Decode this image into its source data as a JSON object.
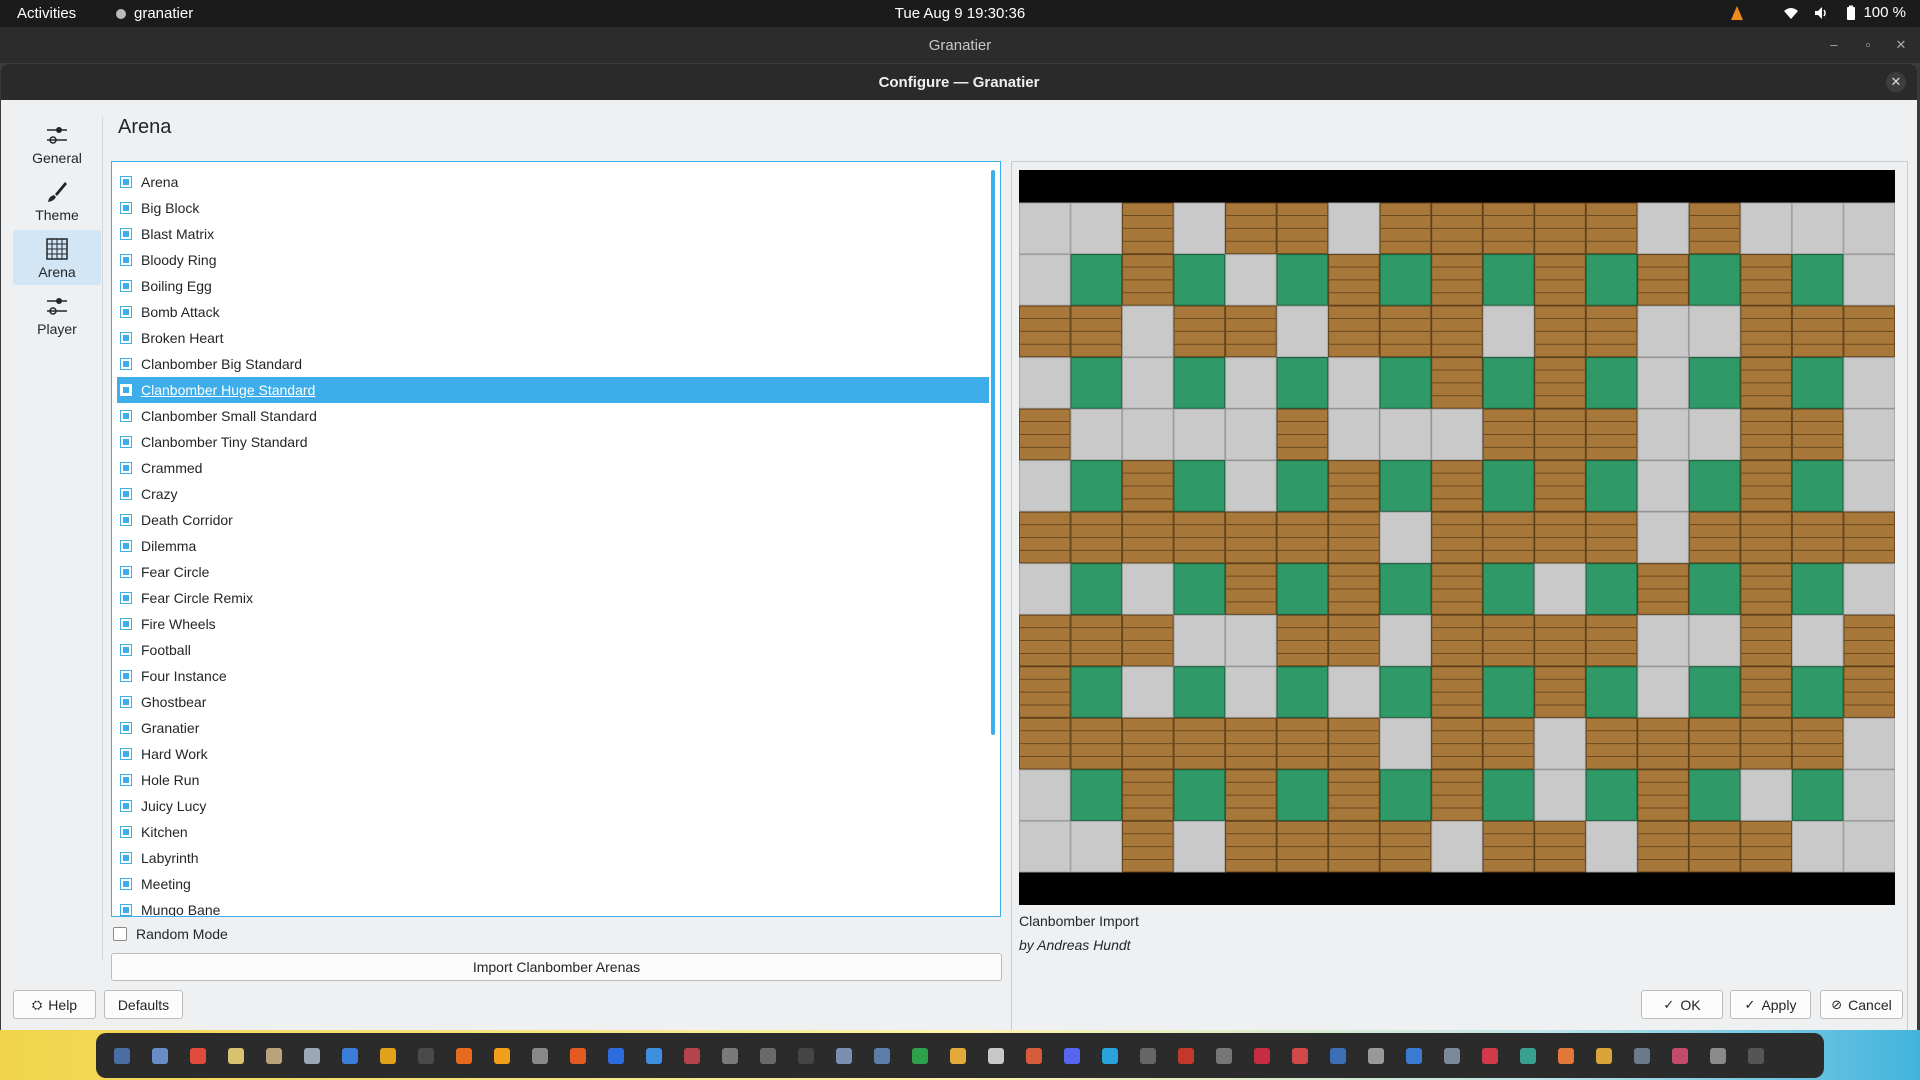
{
  "topbar": {
    "activities": "Activities",
    "app_name": "granatier",
    "clock": "Tue Aug 9  19:30:36",
    "battery": "100 %"
  },
  "window": {
    "title": "Granatier"
  },
  "dialog": {
    "title": "Configure — Granatier",
    "page_title": "Arena",
    "sidebar": [
      {
        "label": "General",
        "icon": "sliders-icon"
      },
      {
        "label": "Theme",
        "icon": "brush-icon"
      },
      {
        "label": "Arena",
        "icon": "grid-icon",
        "active": true
      },
      {
        "label": "Player",
        "icon": "sliders-icon"
      }
    ],
    "arenas": [
      "Arena",
      "Big Block",
      "Blast Matrix",
      "Bloody Ring",
      "Boiling Egg",
      "Bomb Attack",
      "Broken Heart",
      "Clanbomber Big Standard",
      "Clanbomber Huge Standard",
      "Clanbomber Small Standard",
      "Clanbomber Tiny Standard",
      "Crammed",
      "Crazy",
      "Death Corridor",
      "Dilemma",
      "Fear Circle",
      "Fear Circle Remix",
      "Fire Wheels",
      "Football",
      "Four Instance",
      "Ghostbear",
      "Granatier",
      "Hard Work",
      "Hole Run",
      "Juicy Lucy",
      "Kitchen",
      "Labyrinth",
      "Meeting",
      "Mungo Bane"
    ],
    "selected_arena": "Clanbomber Huge Standard",
    "random_mode_label": "Random Mode",
    "import_label": "Import Clanbomber Arenas",
    "preview": {
      "title": "Clanbomber Import",
      "author": "by Andreas Hundt",
      "map": [
        "FFBFBBFBBBBBFBFFF",
        "FGBGFGBGBGBGBGBGF",
        "BBFBBFBBBFBBFFBBB",
        "FGFGFGFGBGBGFGBGF",
        "BFFFFBFFFBBBFFBBF",
        "FGBGFGBGBGBGFGBGF",
        "BBBBBBBFBBBBFBBBB",
        "FGFGBGBGBGFGBGBGF",
        "BBBFFBBFBBBBFFBFB",
        "BGFGFGFGBGBGFGBGB",
        "BBBBBBBFBBFBBBBBF",
        "FGBGBGBGBGFGBGFGF",
        "FFBFBBBBFBBFBBBFF"
      ],
      "colors": {
        "floor": "#c9c9c9",
        "brick": "#a8773a",
        "block": "#2f9a67",
        "bg": "#000000"
      }
    },
    "buttons": {
      "help": "Help",
      "defaults": "Defaults",
      "ok": "OK",
      "apply": "Apply",
      "cancel": "Cancel"
    }
  },
  "taskbar_icons": [
    "#4a6fa5",
    "#6a8cc7",
    "#e14b3b",
    "#d8c26f",
    "#b9a37a",
    "#9aa7b4",
    "#3b7dd8",
    "#e0a21a",
    "#4a4a4a",
    "#e86a1f",
    "#f0a018",
    "#888888",
    "#e35b23",
    "#2d6cdf",
    "#3f8fe0",
    "#b5434e",
    "#7a7a7a",
    "#6a6a6a",
    "#444444",
    "#7b8fb0",
    "#5d7ea8",
    "#2fa04a",
    "#e0a93a",
    "#c8c8c8",
    "#d45c3a",
    "#5865f2",
    "#2aa2dc",
    "#666666",
    "#c0392b",
    "#777777",
    "#c62d42",
    "#d04a4a",
    "#3d6fb6",
    "#999999",
    "#3b7bd4",
    "#7a8a9a",
    "#d03a4a",
    "#3aa190",
    "#e1783a",
    "#d9a33a",
    "#6a7a8a",
    "#c24b6a",
    "#8a8a8a",
    "#555555"
  ]
}
